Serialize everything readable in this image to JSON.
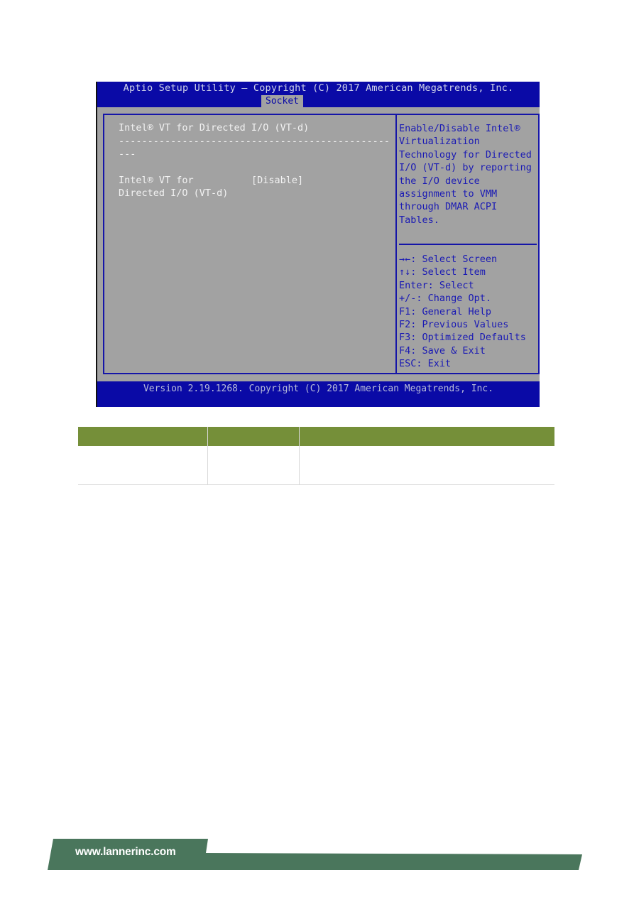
{
  "bios": {
    "title": "Aptio Setup Utility – Copyright (C) 2017 American Megatrends, Inc.",
    "active_tab": "Socket",
    "section_heading": "Intel® VT for Directed I/O (VT-d)",
    "separator_line1": "-----------------------------------------------",
    "separator_line2": "---",
    "settings": [
      {
        "label_line1": "Intel® VT for",
        "label_line2": "Directed I/O (VT-d)",
        "value": "[Disable]"
      }
    ],
    "help_text": [
      "Enable/Disable Intel®",
      "Virtualization",
      "Technology for Directed",
      "I/O (VT-d) by reporting",
      "the I/O device",
      "assignment to VMM",
      "through DMAR ACPI",
      "Tables."
    ],
    "key_legend": [
      {
        "key": "→←",
        "action": ": Select Screen"
      },
      {
        "key": "↑↓",
        "action": ": Select Item"
      },
      {
        "key": "Enter",
        "action": ": Select"
      },
      {
        "key": "+/-",
        "action": ": Change Opt."
      },
      {
        "key": "F1",
        "action": ": General Help"
      },
      {
        "key": "F2",
        "action": ": Previous Values"
      },
      {
        "key": "F3",
        "action": ": Optimized Defaults"
      },
      {
        "key": "F4",
        "action": ": Save & Exit"
      },
      {
        "key": "ESC",
        "action": ": Exit"
      }
    ],
    "footer": "Version 2.19.1268. Copyright (C) 2017 American Megatrends, Inc."
  },
  "table": {
    "header_color": "#758f39",
    "headers": [
      "",
      "",
      ""
    ],
    "rows": [
      [
        "",
        "",
        ""
      ]
    ]
  },
  "page_footer": {
    "url": "www.lannerinc.com",
    "banner_color": "#4a765c"
  }
}
